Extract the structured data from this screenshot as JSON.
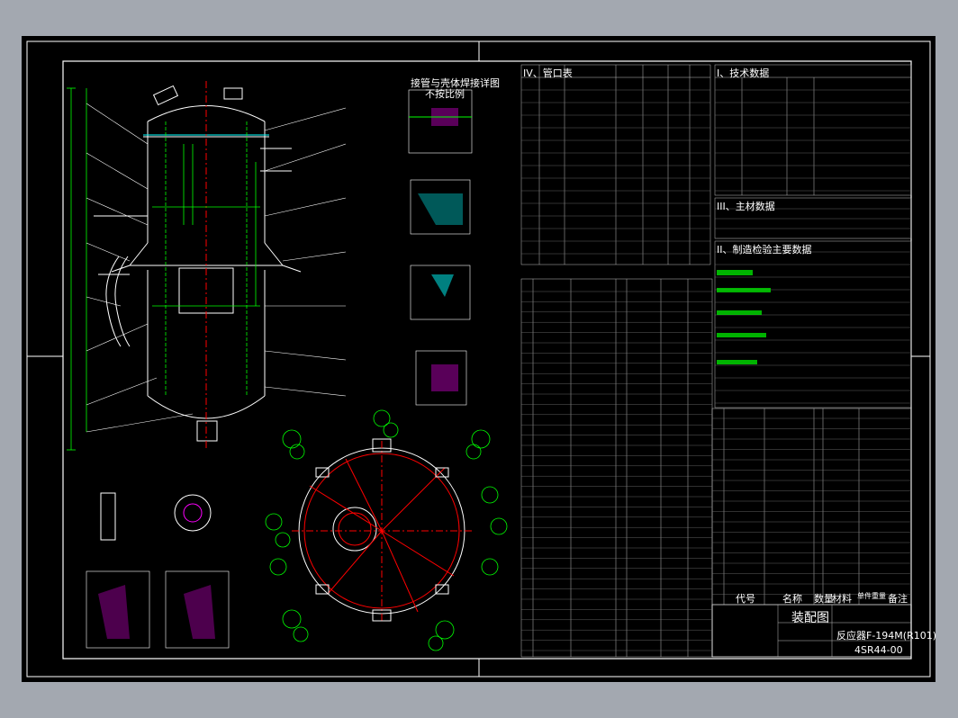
{
  "section_nozzles": "IV、管口表",
  "section_tech": "I、技术数据",
  "section_parts": "III、主材数据",
  "section_inspect": "II、制造检验主要数据",
  "table_headers": [
    "代号",
    "名称",
    "数量",
    "材料",
    "单件重量",
    "备注"
  ],
  "title_block": {
    "drawing_title": "装配图",
    "equipment_name": "反应器F-194M(R101)",
    "drawing_number": "4SR44-00"
  },
  "detail_titles": [
    "接管与壳体焊接详图",
    "不按比例"
  ],
  "colors": {
    "background": "#000000",
    "sheet_border": "#ffffff",
    "drawing_lines": "#ffffff",
    "dimension_lines": "#00ff00",
    "centerlines": "#ff0000",
    "table_text": "#ffffff",
    "table_grid": "#c0c0c0",
    "detail_hatch": "#00ffff",
    "margin": "#a3a8b0"
  }
}
